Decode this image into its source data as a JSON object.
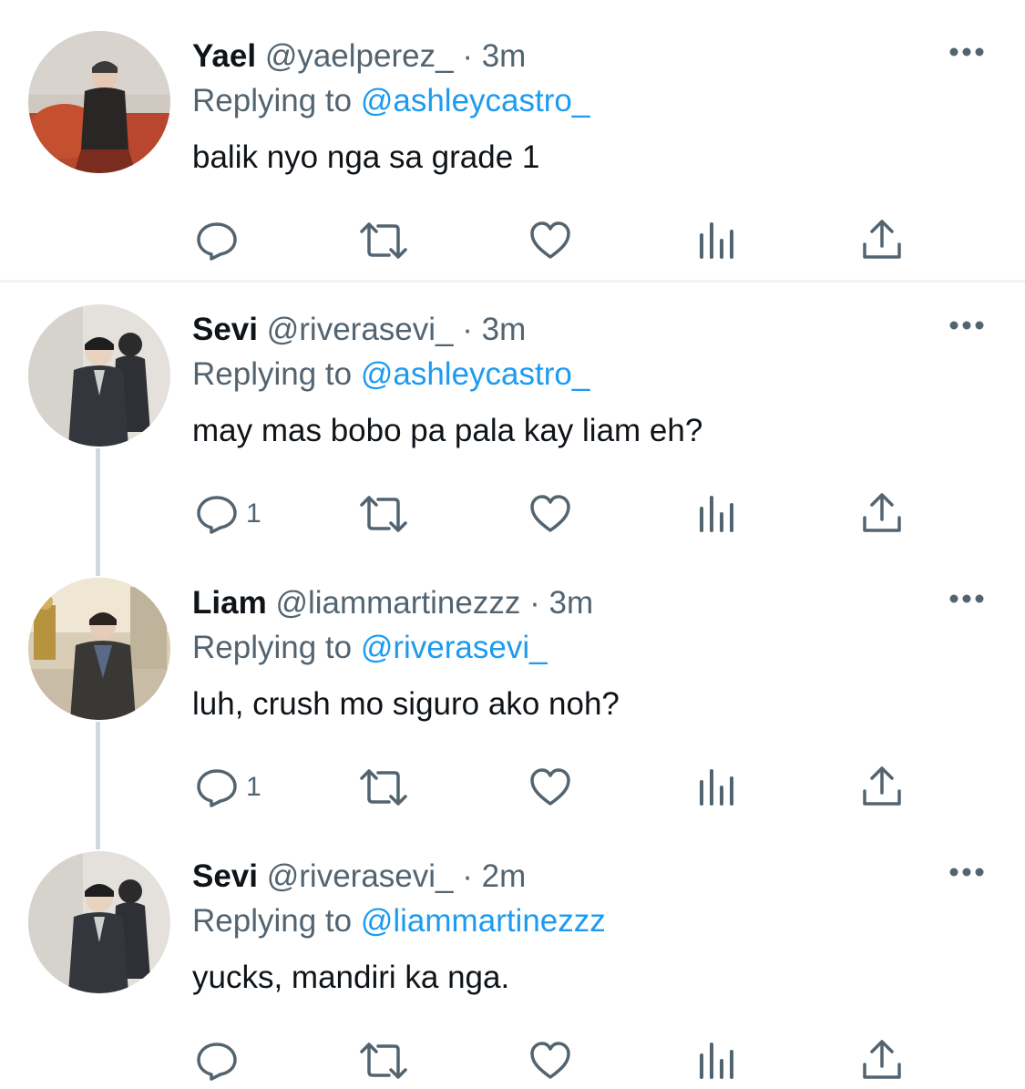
{
  "replying_label": "Replying to",
  "colors": {
    "accent": "#1d9bf0",
    "muted": "#536471",
    "text": "#0f1419",
    "thread_line": "#cfd9de"
  },
  "icons": {
    "more": "more-dots-icon",
    "reply": "reply-bubble-icon",
    "retweet": "retweet-icon",
    "like": "heart-icon",
    "views": "bar-chart-icon",
    "share": "share-upload-icon"
  },
  "tweets": [
    {
      "name": "Yael",
      "handle": "@yaelperez_",
      "separator": "·",
      "time": "3m",
      "replying_to": "@ashleycastro_",
      "text": "balik nyo nga sa grade 1",
      "reply_count": ""
    },
    {
      "name": "Sevi",
      "handle": "@riverasevi_",
      "separator": "·",
      "time": "3m",
      "replying_to": "@ashleycastro_",
      "text": "may mas bobo pa pala kay liam eh?",
      "reply_count": "1"
    },
    {
      "name": "Liam",
      "handle": "@liammartinezzz",
      "separator": "·",
      "time": "3m",
      "replying_to": "@riverasevi_",
      "text": "luh, crush mo siguro ako noh?",
      "reply_count": "1"
    },
    {
      "name": "Sevi",
      "handle": "@riverasevi_",
      "separator": "·",
      "time": "2m",
      "replying_to": "@liammartinezzz",
      "text": "yucks, mandiri ka nga.",
      "reply_count": ""
    }
  ]
}
